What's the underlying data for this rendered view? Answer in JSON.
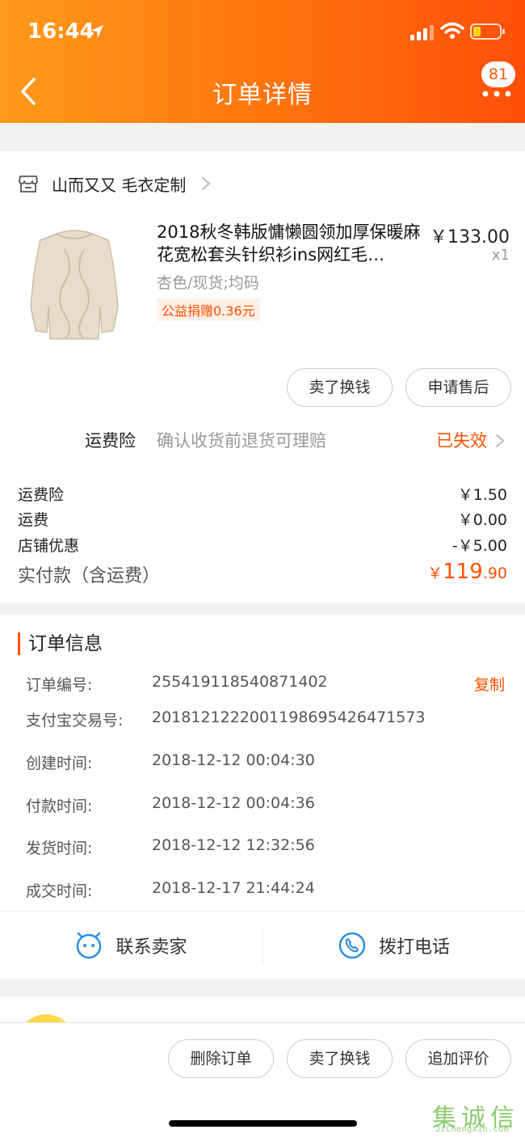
{
  "status_bar": {
    "time": "16:44"
  },
  "header": {
    "title": "订单详情",
    "badge": "81"
  },
  "shop": {
    "name": "山而又又 毛衣定制"
  },
  "product": {
    "title": "2018秋冬韩版慵懒圆领加厚保暖麻花宽松套头针织衫ins网红毛…",
    "price": "￥133.00",
    "quantity": "x1",
    "sku": "杏色/现货;均码",
    "charity_tag": "公益捐赠0.36元"
  },
  "item_actions": {
    "sell_label": "卖了换钱",
    "aftersale_label": "申请售后"
  },
  "insurance": {
    "label": "运费险",
    "desc": "确认收货前退货可理赔",
    "status": "已失效"
  },
  "fees": [
    {
      "label": "运费险",
      "value": "￥1.50"
    },
    {
      "label": "运费",
      "value": "￥0.00"
    },
    {
      "label": "店铺优惠",
      "value": "-￥5.00"
    }
  ],
  "total": {
    "label": "实付款（含运费）",
    "symbol": "￥",
    "integer": "119",
    "decimal": ".90"
  },
  "order_info": {
    "title": "订单信息",
    "copy_label": "复制",
    "rows": [
      {
        "label": "订单编号:",
        "value": "255419118540871402"
      },
      {
        "label": "支付宝交易号:",
        "value": "2018121222001198695426471573"
      },
      {
        "label": "创建时间:",
        "value": "2018-12-12 00:04:30"
      },
      {
        "label": "付款时间:",
        "value": "2018-12-12 00:04:36"
      },
      {
        "label": "发货时间:",
        "value": "2018-12-12 12:32:56"
      },
      {
        "label": "成交时间:",
        "value": "2018-12-17 21:44:24"
      }
    ]
  },
  "contact": {
    "seller_label": "联系卖家",
    "call_label": "拨打电话"
  },
  "bottom_actions": {
    "delete_label": "删除订单",
    "sell_label": "卖了换钱",
    "review_label": "追加评价"
  },
  "watermark": {
    "glyphs": [
      "集",
      "诚",
      "信"
    ],
    "url": "JiChengXin.com"
  },
  "colors": {
    "accent": "#ff5000",
    "header_start": "#ff9a1a",
    "header_end": "#ff4f0a"
  }
}
